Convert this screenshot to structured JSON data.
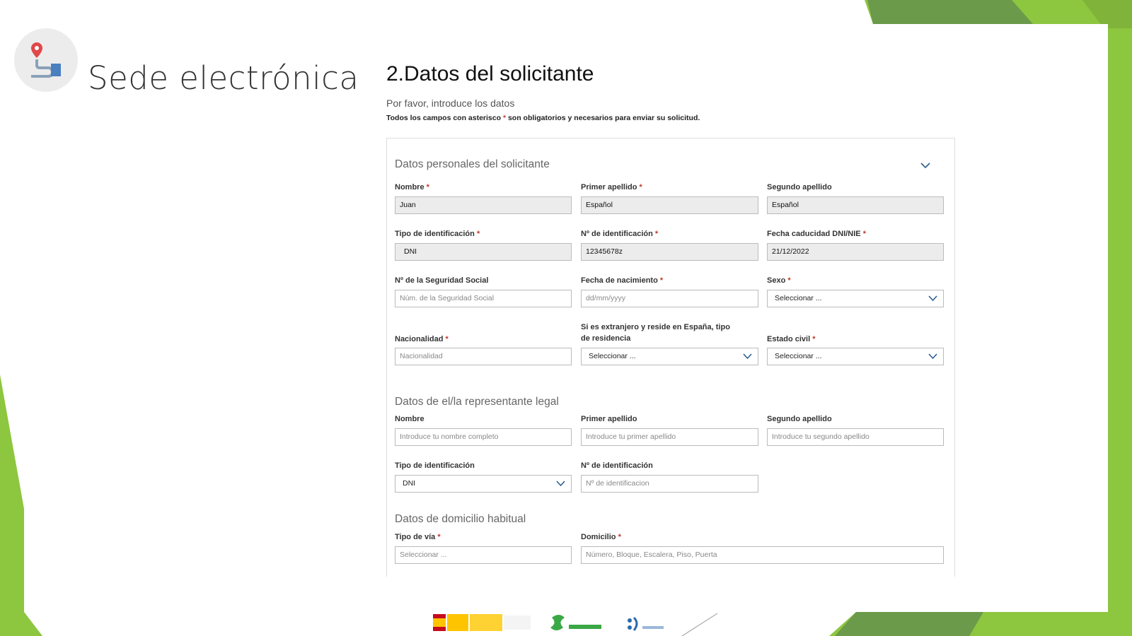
{
  "app": {
    "title": "Sede electrónica",
    "icon": "map-route-icon"
  },
  "form": {
    "title": "2.Datos del solicitante",
    "intro": "Por favor, introduce los datos",
    "required_note_before": "Todos los campos con asterisco ",
    "required_note_star": "*",
    "required_note_after": " son obligatorios y necesarios para enviar su solicitud."
  },
  "personal": {
    "title": "Datos personales del solicitante",
    "nombre": {
      "label": "Nombre",
      "value": "Juan",
      "required": true
    },
    "primer_apellido": {
      "label": "Primer apellido",
      "value": "Español",
      "required": true
    },
    "segundo_apellido": {
      "label": "Segundo apellido",
      "value": "Español"
    },
    "tipo_identificacion": {
      "label": "Tipo de identificación",
      "value": "DNI",
      "required": true
    },
    "num_identificacion": {
      "label": "Nº de identificación",
      "value": "12345678z",
      "required": true
    },
    "fecha_caducidad": {
      "label": "Fecha caducidad DNI/NIE",
      "value": "21/12/2022",
      "required": true
    },
    "seguridad_social": {
      "label": "Nº de la Seguridad Social",
      "placeholder": "Núm. de la Seguridad Social"
    },
    "fecha_nacimiento": {
      "label": "Fecha de nacimiento",
      "placeholder": "dd/mm/yyyy",
      "required": true
    },
    "sexo": {
      "label": "Sexo",
      "value": "Seleccionar ...",
      "required": true
    },
    "nacionalidad": {
      "label": "Nacionalidad",
      "placeholder": "Nacionalidad",
      "required": true
    },
    "tipo_residencia": {
      "label_line1": "Si es extranjero y reside en España, tipo",
      "label_line2": "de residencia",
      "value": "Seleccionar ..."
    },
    "estado_civil": {
      "label": "Estado civil",
      "value": "Seleccionar ...",
      "required": true
    }
  },
  "legal_rep": {
    "title": "Datos de el/la representante legal",
    "nombre": {
      "label": "Nombre",
      "placeholder": "Introduce tu nombre completo"
    },
    "primer_apellido": {
      "label": "Primer apellido",
      "placeholder": "Introduce tu primer apellido"
    },
    "segundo_apellido": {
      "label": "Segundo apellido",
      "placeholder": "Introduce tu segundo apellido"
    },
    "tipo_identificacion": {
      "label": "Tipo de identificación",
      "value": "DNI"
    },
    "num_identificacion": {
      "label": "Nº de identificación",
      "placeholder": "Nº de identificacion"
    }
  },
  "domicilio": {
    "title": "Datos de domicilio habitual",
    "tipo_via": {
      "label": "Tipo de vía",
      "placeholder": "Seleccionar ...",
      "required": true
    },
    "domicilio": {
      "label": "Domicilio",
      "placeholder": "Número, Bloque, Escalera, Piso, Puerta",
      "required": true
    }
  },
  "colors": {
    "accent_green": "#8dc63f",
    "dark_green": "#6a9a4a",
    "chevron_blue": "#2c5d8f",
    "required_red": "#c0392b",
    "filled_bg": "#ececec"
  }
}
